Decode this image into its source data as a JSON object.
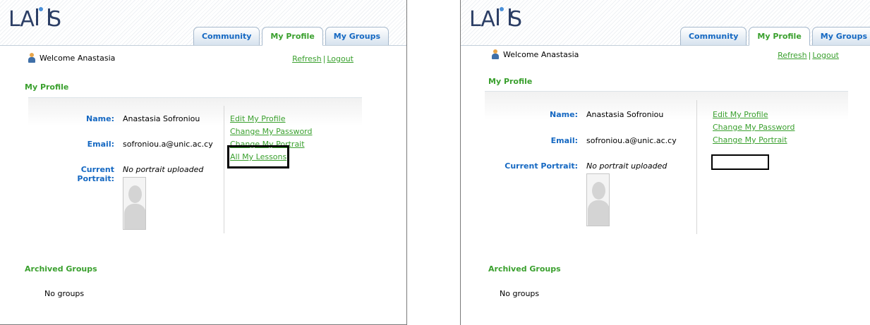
{
  "left": {
    "logo": "LA​S",
    "tabs": [
      "Community",
      "My Profile",
      "My Groups"
    ],
    "welcome": "Welcome Anastasia",
    "refresh": "Refresh",
    "sep": "|",
    "logout": "Logout",
    "section_title": "My Profile",
    "name_label": "Name:",
    "name_value": "Anastasia Sofroniou",
    "email_label": "Email:",
    "email_value": "sofroniou.a@unic.ac.cy",
    "portrait_label": "Current Portrait:",
    "portrait_value": "No portrait uploaded",
    "links": [
      "Edit My Profile",
      "Change My Password",
      "Change My Portrait",
      "All My Lessons"
    ],
    "archived_title": "Archived Groups",
    "no_groups": "No groups"
  },
  "right": {
    "tabs": [
      "Community",
      "My Profile",
      "My Groups"
    ],
    "welcome": "Welcome Anastasia",
    "refresh": "Refresh",
    "sep": "|",
    "logout": "Logout",
    "section_title": "My Profile",
    "name_label": "Name:",
    "name_value": "Anastasia Sofroniou",
    "email_label": "Email:",
    "email_value": "sofroniou.a@unic.ac.cy",
    "portrait_label": "Current Portrait:",
    "portrait_value": "No portrait uploaded",
    "links": [
      "Edit My Profile",
      "Change My Password",
      "Change My Portrait"
    ],
    "archived_title": "Archived Groups",
    "no_groups": "No groups"
  },
  "colors": {
    "accent_green": "#3aa02e",
    "link_blue": "#1568c2",
    "logo_navy": "#2c3f66"
  }
}
